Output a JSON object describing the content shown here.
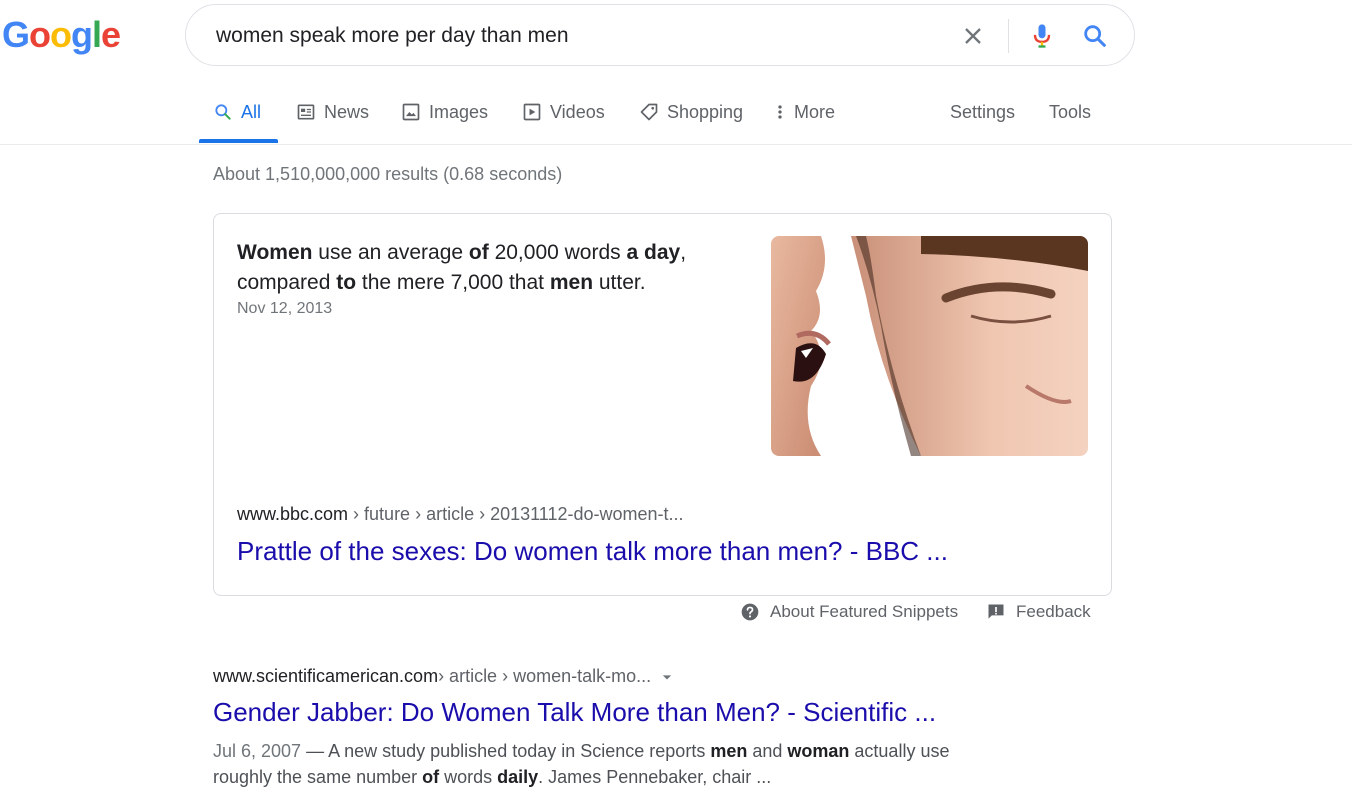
{
  "logo": {
    "letters": [
      "G",
      "o",
      "o",
      "g",
      "l",
      "e"
    ],
    "alt": "Google"
  },
  "search": {
    "query": "women speak more per day than men"
  },
  "tabs": [
    {
      "label": "All",
      "icon": "search-icon",
      "active": true
    },
    {
      "label": "News",
      "icon": "news-icon"
    },
    {
      "label": "Images",
      "icon": "image-icon"
    },
    {
      "label": "Videos",
      "icon": "video-icon"
    },
    {
      "label": "Shopping",
      "icon": "tag-icon"
    },
    {
      "label": "More",
      "icon": "more-vert-icon"
    }
  ],
  "tools": {
    "settings": "Settings",
    "tools": "Tools"
  },
  "stats": "About 1,510,000,000 results (0.68 seconds)",
  "featured": {
    "text_parts": [
      {
        "t": "Women",
        "b": true
      },
      {
        "t": " use an average ",
        "b": false
      },
      {
        "t": "of",
        "b": true
      },
      {
        "t": " 20,000 words ",
        "b": false
      },
      {
        "t": "a day",
        "b": true
      },
      {
        "t": ", compared ",
        "b": false
      },
      {
        "t": "to",
        "b": true
      },
      {
        "t": " the mere 7,000 that ",
        "b": false
      },
      {
        "t": "men",
        "b": true
      },
      {
        "t": " utter.",
        "b": false
      }
    ],
    "date": "Nov 12, 2013",
    "image_alt": "woman whispering into man's ear",
    "cite_domain": "www.bbc.com",
    "cite_path": " › future › article › 20131112-do-women-t...",
    "title": "Prattle of the sexes: Do women talk more than men? - BBC ..."
  },
  "snippet_meta": {
    "about": "About Featured Snippets",
    "feedback": "Feedback"
  },
  "result2": {
    "cite_domain": "www.scientificamerican.com",
    "cite_path": " › article › women-talk-mo...",
    "title": "Gender Jabber: Do Women Talk More than Men? - Scientific ...",
    "date": "Jul 6, 2007",
    "snippet_parts": [
      {
        "t": " — A new study published today in Science reports ",
        "b": false
      },
      {
        "t": "men",
        "b": true
      },
      {
        "t": " and ",
        "b": false
      },
      {
        "t": "woman",
        "b": true
      },
      {
        "t": " actually use roughly the same number ",
        "b": false
      },
      {
        "t": "of",
        "b": true
      },
      {
        "t": " words ",
        "b": false
      },
      {
        "t": "daily",
        "b": true
      },
      {
        "t": ". James Pennebaker, chair ...",
        "b": false
      }
    ]
  },
  "colors": {
    "link": "#1a0dab",
    "accent": "#1a73e8",
    "muted": "#70757a"
  }
}
